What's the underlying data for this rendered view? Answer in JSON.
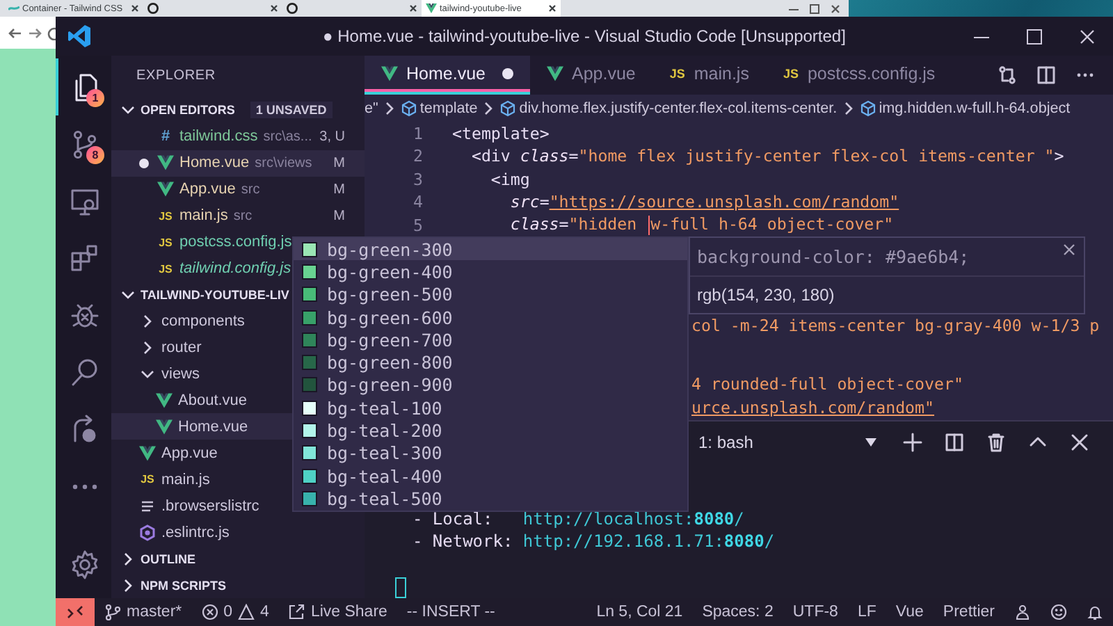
{
  "browser": {
    "tabs": [
      {
        "title": "Container - Tailwind CSS",
        "kind": "wave",
        "selected": false
      },
      {
        "kind": "github",
        "selected": false
      },
      {
        "kind": "github",
        "selected": false
      },
      {
        "title": "tailwind-youtube-live",
        "kind": "vue",
        "selected": true
      }
    ]
  },
  "window": {
    "title": "● Home.vue - tailwind-youtube-live - Visual Studio Code [Unsupported]"
  },
  "activity_bar": [
    {
      "kind": "explorer",
      "selected": true,
      "badge": "1"
    },
    {
      "kind": "source-control",
      "selected": false,
      "badge": "8"
    },
    {
      "kind": "remote",
      "selected": false
    },
    {
      "kind": "extensions",
      "selected": false
    },
    {
      "kind": "debug",
      "selected": false
    },
    {
      "kind": "search",
      "selected": false
    },
    {
      "kind": "live-share",
      "selected": false
    },
    {
      "kind": "more",
      "selected": false
    },
    {
      "kind": "settings",
      "selected": false
    }
  ],
  "sidebar": {
    "title": "EXPLORER",
    "sections": [
      {
        "kind": "open-editors",
        "title": "OPEN EDITORS",
        "badge": "1 UNSAVED",
        "expanded": true,
        "items": [
          {
            "kind": "css",
            "glyph": "#",
            "name": "tailwind.css",
            "path": "src\\as...",
            "badge": "3, U",
            "color": "#7fc99a",
            "dirty": false,
            "selected": false,
            "preview": false
          },
          {
            "kind": "vue",
            "name": "Home.vue",
            "path": "src\\views",
            "badge": "M",
            "color": "#e6d2b0",
            "dirty": true,
            "selected": true,
            "preview": false
          },
          {
            "kind": "vue",
            "name": "App.vue",
            "path": "src",
            "badge": "M",
            "color": "#e6d2b0",
            "dirty": false,
            "selected": false,
            "preview": false
          },
          {
            "kind": "js",
            "glyph": "JS",
            "name": "main.js",
            "path": "src",
            "badge": "M",
            "color": "#e6d2b0",
            "dirty": false,
            "selected": false,
            "preview": false
          },
          {
            "kind": "js",
            "glyph": "JS",
            "name": "postcss.config.js",
            "color": "#6fcfb0",
            "dirty": false,
            "selected": false,
            "preview": false
          },
          {
            "kind": "js",
            "glyph": "JS",
            "name": "tailwind.config.js",
            "color": "#6fcfb0",
            "dirty": false,
            "selected": false,
            "preview": true
          }
        ]
      },
      {
        "kind": "tree",
        "title": "TAILWIND-YOUTUBE-LIV",
        "expanded": true,
        "items": [
          {
            "kind": "folder",
            "name": "components",
            "expanded": false
          },
          {
            "kind": "folder",
            "name": "router",
            "expanded": false
          },
          {
            "kind": "folder",
            "name": "views",
            "expanded": true,
            "children": [
              {
                "kind": "vue",
                "name": "About.vue",
                "selected": false
              },
              {
                "kind": "vue",
                "name": "Home.vue",
                "selected": true
              }
            ]
          },
          {
            "kind": "vue",
            "name": "App.vue",
            "selected": false
          },
          {
            "kind": "js",
            "glyph": "JS",
            "name": "main.js",
            "selected": false
          },
          {
            "kind": "list",
            "name": ".browserslistrc",
            "selected": false
          },
          {
            "kind": "eslint",
            "name": ".eslintrc.js",
            "selected": false
          }
        ]
      },
      {
        "title": "OUTLINE",
        "expanded": false
      },
      {
        "title": "NPM SCRIPTS",
        "expanded": false
      }
    ]
  },
  "editor": {
    "tabs": [
      {
        "label": "Home.vue",
        "kind": "vue",
        "selected": true,
        "dirty": true
      },
      {
        "label": "App.vue",
        "kind": "vue",
        "selected": false,
        "dirty": false
      },
      {
        "label": "main.js",
        "kind": "js",
        "glyph": "JS",
        "selected": false,
        "dirty": false
      },
      {
        "label": "postcss.config.js",
        "kind": "js",
        "glyph": "JS",
        "selected": false,
        "dirty": false
      }
    ],
    "breadcrumb": [
      {
        "kind": "text",
        "text": "e\""
      },
      {
        "kind": "element",
        "text": "template"
      },
      {
        "kind": "element",
        "text": "div.home.flex.justify-center.flex-col.items-center."
      },
      {
        "kind": "element",
        "text": "img.hidden.w-full.h-64.object"
      }
    ],
    "lines": [
      {
        "number": "1",
        "tokens": [
          {
            "kind": "tag",
            "text": "<template>"
          }
        ]
      },
      {
        "number": "2",
        "tokens": [
          {
            "kind": "tag",
            "text": "  <div "
          },
          {
            "kind": "attr",
            "text": "class"
          },
          {
            "kind": "punct",
            "text": "="
          },
          {
            "kind": "string",
            "text": "\"home flex justify-center flex-col items-center \""
          },
          {
            "kind": "tag",
            "text": ">"
          }
        ]
      },
      {
        "number": "3",
        "tokens": [
          {
            "kind": "tag",
            "text": "    <img"
          }
        ]
      },
      {
        "number": "4",
        "tokens": [
          {
            "kind": "attr",
            "text": "      src"
          },
          {
            "kind": "punct",
            "text": "="
          },
          {
            "kind": "link",
            "text": "\"https://source.unsplash.com/random\""
          }
        ]
      },
      {
        "number": "5",
        "tokens": [
          {
            "kind": "attr",
            "text": "      class"
          },
          {
            "kind": "punct",
            "text": "="
          },
          {
            "kind": "string",
            "text": "\"hidden "
          },
          {
            "kind": "cursor"
          },
          {
            "kind": "string",
            "text": "w-full h-64 object-cover\""
          }
        ]
      }
    ],
    "covered_fragments": [
      {
        "kind": "string",
        "text": "col -m-24 items-center bg-gray-400 w-1/3 p"
      },
      {
        "kind": "string",
        "text": "4 rounded-full object-cover\""
      },
      {
        "kind": "link",
        "text": "urce.unsplash.com/random\""
      }
    ],
    "suggestions": [
      {
        "label": "bg-green-300",
        "color": "#9ae6b4",
        "selected": true
      },
      {
        "label": "bg-green-400",
        "color": "#68d391",
        "selected": false
      },
      {
        "label": "bg-green-500",
        "color": "#48bb78",
        "selected": false
      },
      {
        "label": "bg-green-600",
        "color": "#38a169",
        "selected": false
      },
      {
        "label": "bg-green-700",
        "color": "#2f855a",
        "selected": false
      },
      {
        "label": "bg-green-800",
        "color": "#276749",
        "selected": false
      },
      {
        "label": "bg-green-900",
        "color": "#22543d",
        "selected": false
      },
      {
        "label": "bg-teal-100",
        "color": "#e6fffa",
        "selected": false
      },
      {
        "label": "bg-teal-200",
        "color": "#b2f5ea",
        "selected": false
      },
      {
        "label": "bg-teal-300",
        "color": "#81e6d9",
        "selected": false
      },
      {
        "label": "bg-teal-400",
        "color": "#4fd1c5",
        "selected": false
      },
      {
        "label": "bg-teal-500",
        "color": "#38b2ac",
        "selected": false
      }
    ],
    "hover": {
      "declaration": "background-color: #9ae6b4;",
      "value": "rgb(154, 230, 180)"
    }
  },
  "terminal": {
    "selector": "1: bash",
    "lines": [
      [
        {
          "kind": "plain",
          "text": "  - Local:   "
        },
        {
          "kind": "url",
          "text": "http://localhost:"
        },
        {
          "kind": "port",
          "text": "8080"
        },
        {
          "kind": "url",
          "text": "/"
        }
      ],
      [
        {
          "kind": "plain",
          "text": "  - Network: "
        },
        {
          "kind": "url",
          "text": "http://192.168.1.71:"
        },
        {
          "kind": "port",
          "text": "8080"
        },
        {
          "kind": "url",
          "text": "/"
        }
      ]
    ]
  },
  "status_bar": {
    "left": [
      {
        "kind": "remote"
      },
      {
        "kind": "branch",
        "text": "master*"
      },
      {
        "kind": "problems",
        "errors": "0",
        "warnings": "4"
      },
      {
        "kind": "live-share",
        "text": "Live Share"
      },
      {
        "kind": "plain",
        "text": "-- INSERT --"
      }
    ],
    "right": [
      {
        "kind": "plain",
        "text": "Ln 5, Col 21"
      },
      {
        "kind": "plain",
        "text": "Spaces: 2"
      },
      {
        "kind": "plain",
        "text": "UTF-8"
      },
      {
        "kind": "plain",
        "text": "LF"
      },
      {
        "kind": "plain",
        "text": "Vue"
      },
      {
        "kind": "plain",
        "text": "Prettier"
      },
      {
        "kind": "feedback"
      },
      {
        "kind": "smiley"
      },
      {
        "kind": "bell"
      }
    ]
  }
}
